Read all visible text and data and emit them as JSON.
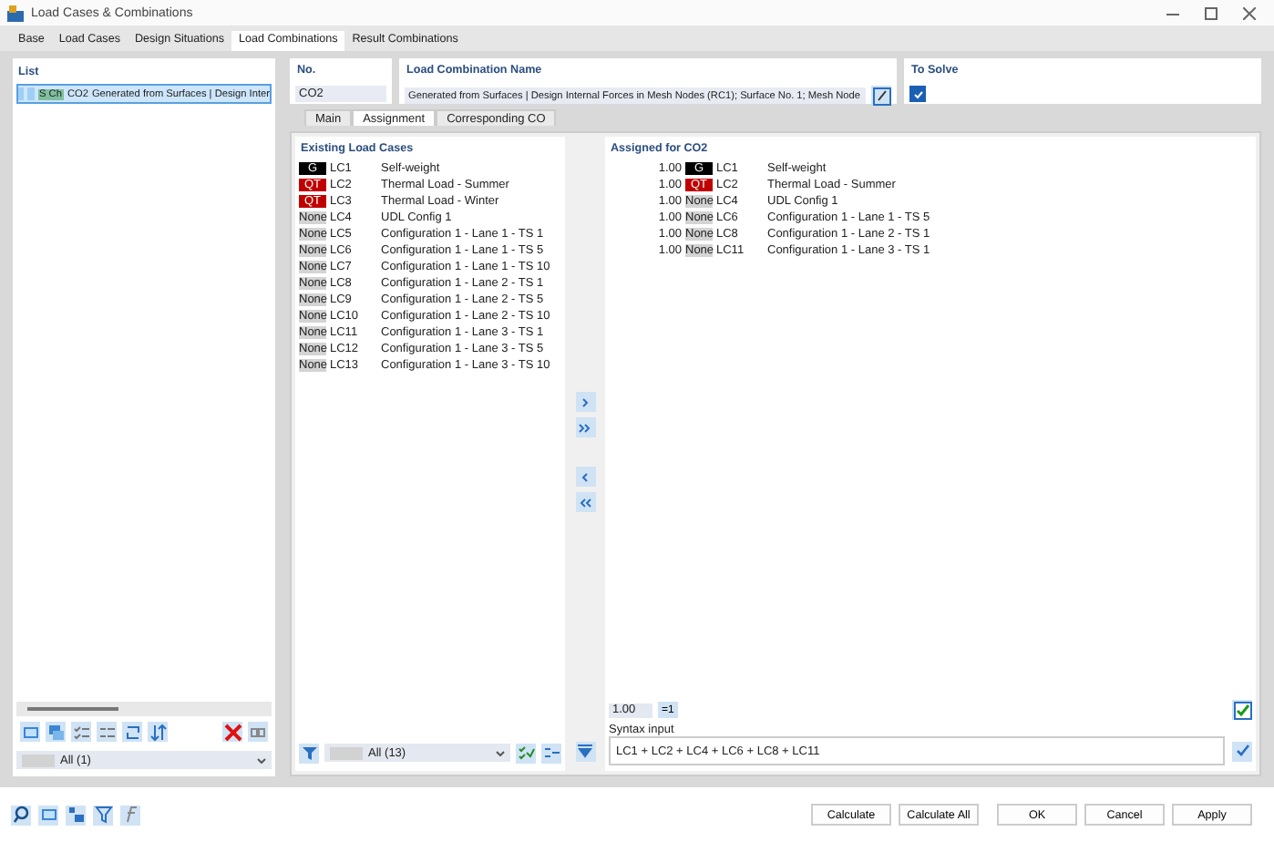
{
  "window": {
    "title": "Load Cases & Combinations"
  },
  "tabs": [
    {
      "label": "Base",
      "selected": false
    },
    {
      "label": "Load Cases",
      "selected": false
    },
    {
      "label": "Design Situations",
      "selected": false
    },
    {
      "label": "Load Combinations",
      "selected": true
    },
    {
      "label": "Result Combinations",
      "selected": false
    }
  ],
  "list": {
    "title": "List",
    "items": [
      {
        "tag": "S Ch",
        "color": "#7fbf9f",
        "no": "CO2",
        "name": "Generated from Surfaces | Design Inter",
        "selected": true
      }
    ],
    "filter": "All (1)"
  },
  "number": {
    "label": "No.",
    "value": "CO2"
  },
  "combination_name": {
    "label": "Load Combination Name",
    "value": "Generated from Surfaces | Design Internal Forces in Mesh Nodes (RC1); Surface No. 1; Mesh Node"
  },
  "to_solve": {
    "label": "To Solve",
    "checked": true
  },
  "subtabs": [
    {
      "label": "Main",
      "selected": false
    },
    {
      "label": "Assignment",
      "selected": true
    },
    {
      "label": "Corresponding CO",
      "selected": false
    }
  ],
  "existing": {
    "title": "Existing Load Cases",
    "filter": "All (13)",
    "rows": [
      {
        "type": "G",
        "color": "#000000",
        "lc": "LC1",
        "name": "Self-weight"
      },
      {
        "type": "QT",
        "color": "#c00000",
        "lc": "LC2",
        "name": "Thermal Load - Summer"
      },
      {
        "type": "QT",
        "color": "#c00000",
        "lc": "LC3",
        "name": "Thermal Load - Winter"
      },
      {
        "type": "None",
        "color": "#d4d4d4",
        "lc": "LC4",
        "name": "UDL Config 1"
      },
      {
        "type": "None",
        "color": "#d4d4d4",
        "lc": "LC5",
        "name": "Configuration 1 - Lane 1 - TS 1"
      },
      {
        "type": "None",
        "color": "#d4d4d4",
        "lc": "LC6",
        "name": "Configuration 1 - Lane 1 - TS 5"
      },
      {
        "type": "None",
        "color": "#d4d4d4",
        "lc": "LC7",
        "name": "Configuration 1 - Lane 1 - TS 10"
      },
      {
        "type": "None",
        "color": "#d4d4d4",
        "lc": "LC8",
        "name": "Configuration 1 - Lane 2 - TS 1"
      },
      {
        "type": "None",
        "color": "#d4d4d4",
        "lc": "LC9",
        "name": "Configuration 1 - Lane 2 - TS 5"
      },
      {
        "type": "None",
        "color": "#d4d4d4",
        "lc": "LC10",
        "name": "Configuration 1 - Lane 2 - TS 10"
      },
      {
        "type": "None",
        "color": "#d4d4d4",
        "lc": "LC11",
        "name": "Configuration 1 - Lane 3 - TS 1"
      },
      {
        "type": "None",
        "color": "#d4d4d4",
        "lc": "LC12",
        "name": "Configuration 1 - Lane 3 - TS 5"
      },
      {
        "type": "None",
        "color": "#d4d4d4",
        "lc": "LC13",
        "name": "Configuration 1 - Lane 3 - TS 10"
      }
    ]
  },
  "assigned": {
    "title": "Assigned for CO2",
    "rows": [
      {
        "factor": "1.00",
        "type": "G",
        "color": "#000000",
        "lc": "LC1",
        "name": "Self-weight"
      },
      {
        "factor": "1.00",
        "type": "QT",
        "color": "#c00000",
        "lc": "LC2",
        "name": "Thermal Load - Summer"
      },
      {
        "factor": "1.00",
        "type": "None",
        "color": "#d4d4d4",
        "lc": "LC4",
        "name": "UDL Config 1"
      },
      {
        "factor": "1.00",
        "type": "None",
        "color": "#d4d4d4",
        "lc": "LC6",
        "name": "Configuration 1 - Lane 1 - TS 5"
      },
      {
        "factor": "1.00",
        "type": "None",
        "color": "#d4d4d4",
        "lc": "LC8",
        "name": "Configuration 1 - Lane 2 - TS 1"
      },
      {
        "factor": "1.00",
        "type": "None",
        "color": "#d4d4d4",
        "lc": "LC11",
        "name": "Configuration 1 - Lane 3 - TS 1"
      }
    ]
  },
  "factor_input": {
    "value": "1.00"
  },
  "set_factor_button": "=1",
  "syntax": {
    "label": "Syntax input",
    "value": "LC1 + LC2 + LC4 + LC6 + LC8 + LC11"
  },
  "buttons": [
    "Calculate",
    "Calculate All",
    "OK",
    "Cancel",
    "Apply"
  ]
}
